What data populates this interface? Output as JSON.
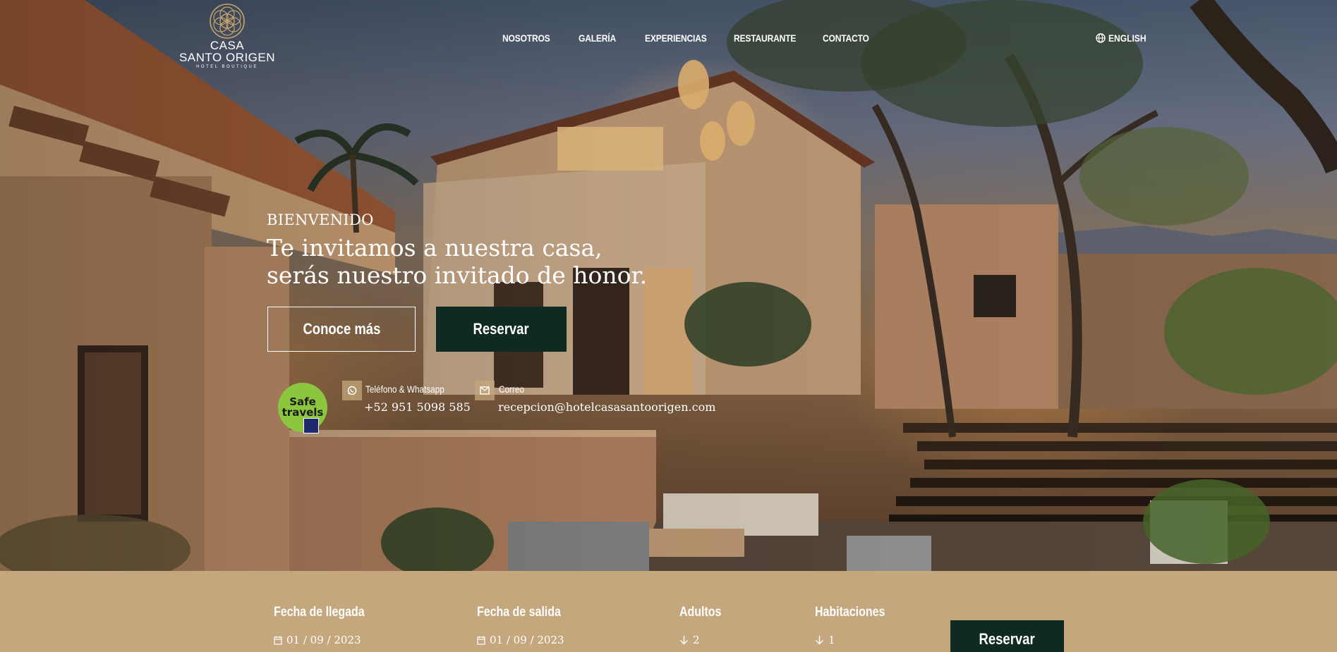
{
  "brand": {
    "line1": "CASA",
    "line2": "SANTO ORIGEN",
    "tagline": "HOTEL BOUTIQUE",
    "gold": "#c9a56b"
  },
  "nav": {
    "items": [
      "NOSOTROS",
      "GALERÍA",
      "EXPERIENCIAS",
      "RESTAURANTE",
      "CONTACTO"
    ],
    "language": "ENGLISH",
    "language_icon": "globe-icon"
  },
  "hero": {
    "eyebrow": "BIENVENIDO",
    "headline_line1": "Te invitamos a nuestra casa,",
    "headline_line2": "serás nuestro invitado de honor.",
    "cta_secondary": "Conoce más",
    "cta_primary": "Reservar",
    "badge_line1": "Safe",
    "badge_line2": "travels"
  },
  "contact": {
    "phone_label": "Teléfono & Whatsapp",
    "phone_value": "+52 951 5098 585",
    "phone_icon": "whatsapp-icon",
    "email_label": "Correo",
    "email_value": "recepcion@hotelcasasantoorigen.com",
    "email_icon": "envelope-icon"
  },
  "booking": {
    "checkin_label": "Fecha de llegada",
    "checkin_value": "01 / 09 / 2023",
    "checkout_label": "Fecha de salida",
    "checkout_value": "01 / 09 / 2023",
    "adults_label": "Adultos",
    "adults_value": "2",
    "rooms_label": "Habitaciones",
    "rooms_value": "1",
    "submit": "Reservar"
  },
  "colors": {
    "accent_dark_green": "#0e2a22",
    "sand": "#c4a77d",
    "badge_green": "#8cc63f"
  }
}
